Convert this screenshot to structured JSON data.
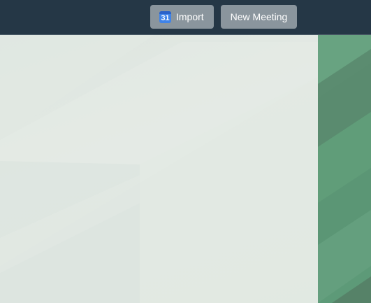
{
  "toolbar": {
    "import_label": "Import",
    "import_icon": "google-calendar-icon",
    "import_icon_number": "31",
    "new_meeting_label": "New Meeting"
  },
  "colors": {
    "topbar": "#253746",
    "button": "#8a959d",
    "background": "#dfe7e2",
    "accent_panel": "#5d9a78",
    "calendar_icon": "#3f83e8"
  }
}
